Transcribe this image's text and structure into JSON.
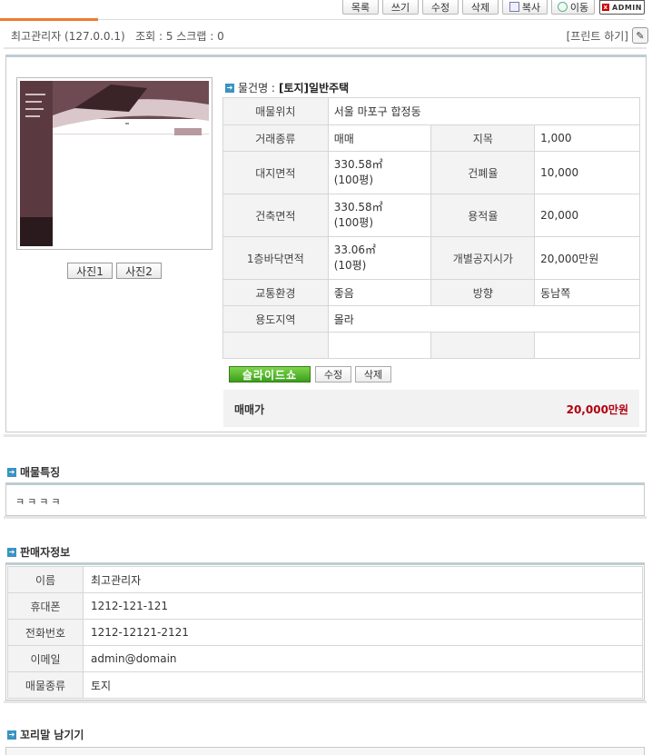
{
  "toolbar": {
    "buttons": [
      "목록",
      "쓰기",
      "수정",
      "삭제",
      "복사",
      "이동"
    ],
    "admin_label": "ADMIN"
  },
  "info": {
    "author": "최고관리자 (127.0.0.1)",
    "views": "조회 : 5 스크랩 : 0",
    "print": "[프린트 하기]"
  },
  "photo_buttons": [
    "사진1",
    "사진2"
  ],
  "property": {
    "title_label": "물건명 :",
    "title_value": "[토지]일반주택",
    "rows": [
      {
        "label": "매물위치",
        "value": "서울 마포구 합정동"
      },
      {
        "label": "거래종류",
        "value": "매매",
        "label2": "지목",
        "value2": "1,000"
      },
      {
        "label": "대지면적",
        "value": "330.58㎡",
        "value_sub": "(100평)",
        "label2": "건폐율",
        "value2": "10,000"
      },
      {
        "label": "건축면적",
        "value": "330.58㎡",
        "value_sub": "(100평)",
        "label2": "용적율",
        "value2": "20,000"
      },
      {
        "label": "1층바닥면적",
        "value": "33.06㎡",
        "value_sub": "(10평)",
        "label2": "개별공지시가",
        "value2": "20,000만원"
      },
      {
        "label": "교통환경",
        "value": "좋음",
        "label2": "방향",
        "value2": "동남쪽"
      },
      {
        "label": "용도지역",
        "value": "몰라"
      }
    ]
  },
  "actions": {
    "slideshow": "슬라이드쇼",
    "edit": "수정",
    "delete": "삭제"
  },
  "price": {
    "label": "매매가",
    "value": "20,000만원"
  },
  "features": {
    "title": "매물특징",
    "text": "ㅋㅋㅋㅋ"
  },
  "seller": {
    "title": "판매자정보",
    "rows": [
      {
        "label": "이름",
        "value": "최고관리자"
      },
      {
        "label": "휴대폰",
        "value": "1212-121-121"
      },
      {
        "label": "전화번호",
        "value": "1212-12121-2121"
      },
      {
        "label": "이메일",
        "value": "admin@domain"
      },
      {
        "label": "매물종류",
        "value": "토지"
      }
    ]
  },
  "comment": {
    "title": "꼬리말 남기기"
  },
  "colors": {
    "accent_orange": "#f07a2c",
    "price_red": "#b0000e",
    "slideshow_green": "#3b9f1c",
    "section_icon_blue": "#3a93c2"
  }
}
